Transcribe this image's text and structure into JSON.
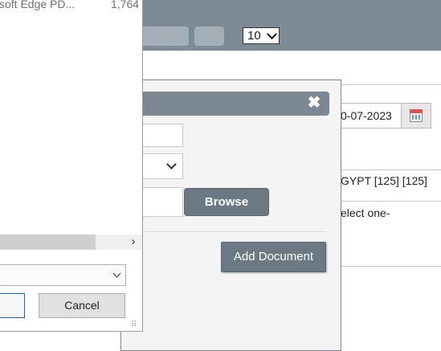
{
  "toolbar": {
    "page_size": "10"
  },
  "form": {
    "date_value": "0-07-2023",
    "branch_text": "GYPT  [125] [125]",
    "select_placeholder": "elect one-"
  },
  "modal": {
    "close_glyph": "✖",
    "browse_label": "Browse",
    "add_document_label": "Add Document"
  },
  "file_dialog": {
    "file_name": "soft Edge PD...",
    "file_size": "1,764",
    "cancel_label": "Cancel",
    "scroll_right_glyph": "›",
    "grip_glyph": "⠿"
  }
}
